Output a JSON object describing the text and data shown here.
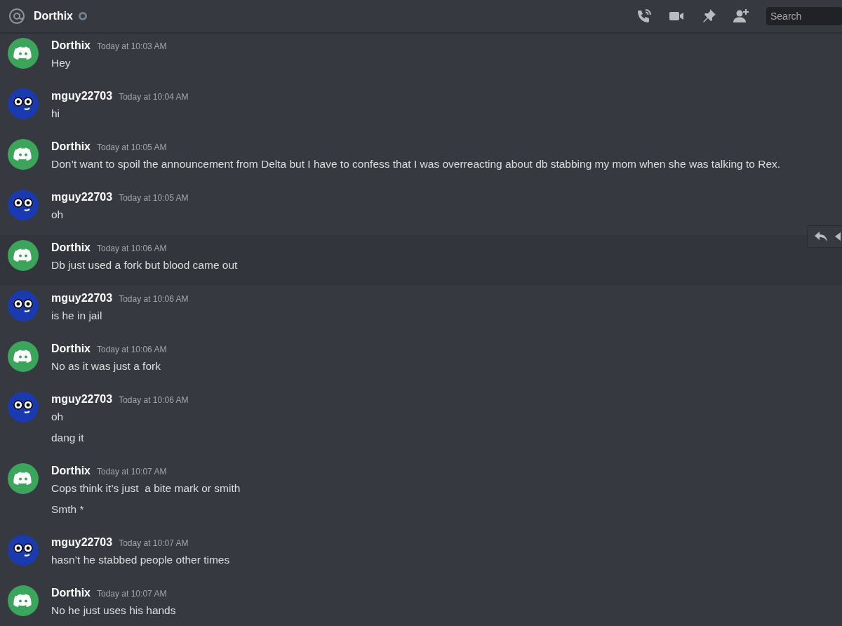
{
  "header": {
    "title": "Dorthix",
    "online": false,
    "search": {
      "placeholder": "Search"
    }
  },
  "messages": [
    {
      "author": "Dorthix",
      "kind": "logo",
      "time": "Today at 10:03 AM",
      "hovered": false,
      "lines": [
        "Hey"
      ]
    },
    {
      "author": "mguy22703",
      "kind": "character",
      "time": "Today at 10:04 AM",
      "hovered": false,
      "lines": [
        "hi"
      ]
    },
    {
      "author": "Dorthix",
      "kind": "logo",
      "time": "Today at 10:05 AM",
      "hovered": false,
      "lines": [
        "Don’t want to spoil the announcement from Delta but I have to confess that I was overreacting about db stabbing my mom when she was talking to Rex."
      ]
    },
    {
      "author": "mguy22703",
      "kind": "character",
      "time": "Today at 10:05 AM",
      "hovered": false,
      "lines": [
        "oh"
      ]
    },
    {
      "author": "Dorthix",
      "kind": "logo",
      "time": "Today at 10:06 AM",
      "hovered": true,
      "lines": [
        "Db just used a fork but blood came out"
      ]
    },
    {
      "author": "mguy22703",
      "kind": "character",
      "time": "Today at 10:06 AM",
      "hovered": false,
      "lines": [
        "is he in jail"
      ]
    },
    {
      "author": "Dorthix",
      "kind": "logo",
      "time": "Today at 10:06 AM",
      "hovered": false,
      "lines": [
        "No as it was just a fork"
      ]
    },
    {
      "author": "mguy22703",
      "kind": "character",
      "time": "Today at 10:06 AM",
      "hovered": false,
      "lines": [
        "oh",
        "dang it"
      ]
    },
    {
      "author": "Dorthix",
      "kind": "logo",
      "time": "Today at 10:07 AM",
      "hovered": false,
      "lines": [
        "Cops think it’s just  a bite mark or smith",
        "Smth *"
      ]
    },
    {
      "author": "mguy22703",
      "kind": "character",
      "time": "Today at 10:07 AM",
      "hovered": false,
      "lines": [
        "hasn’t he stabbed people other times"
      ]
    },
    {
      "author": "Dorthix",
      "kind": "logo",
      "time": "Today at 10:07 AM",
      "hovered": false,
      "lines": [
        "No he just uses his hands"
      ]
    }
  ]
}
